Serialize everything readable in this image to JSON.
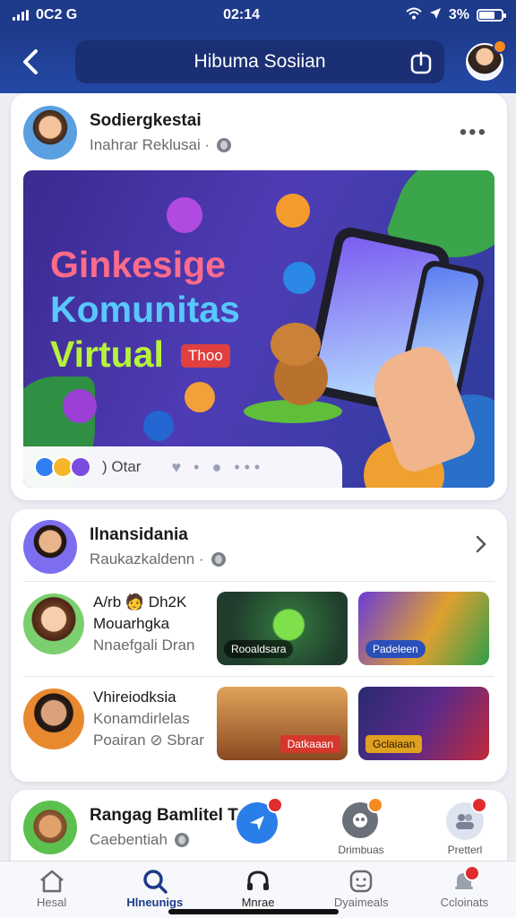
{
  "status": {
    "carrier": "0C2 G",
    "time": "02:14",
    "battery": "3%"
  },
  "header": {
    "title": "Hibuma Sosiian"
  },
  "post": {
    "author": "Sodiergkestai",
    "subtitle": "Inahrar Reklusai ·",
    "banner": {
      "line1": "Ginkesige",
      "line2": "Komunitas",
      "line3": "Virtual",
      "badge": "Thoo"
    },
    "reactions_count": ") Otar"
  },
  "friends_card": {
    "name": "Ilnansidania",
    "subtitle": "Raukazkaldenn ·",
    "rows": [
      {
        "line1": "A/rb 🧑 Dh2K",
        "line2": "Mouarhgka",
        "line3": "Nnaefgali Dran",
        "thumb1_label": "Rooaldsara",
        "thumb2_label": "Padeleen"
      },
      {
        "line1": "Vhireiodksia",
        "line2": "Konamdirlelas",
        "line3": "Poairan ⊘ Sbrar",
        "thumb1_label": "Datkaaan",
        "thumb2_label": "Gclaiaan"
      }
    ]
  },
  "bottom_card": {
    "name": "Rangag Bamlitel T",
    "subtitle": "Caebentiah",
    "fab1_label": "Drimbuas",
    "fab2_label": "Pretterl"
  },
  "nav": {
    "items": [
      "Hesal",
      "Hlneunigs",
      "Mnrae",
      "Dyaimeals",
      "Ccloinats"
    ],
    "active_index": 1
  },
  "colors": {
    "primary": "#1e3a8a",
    "badge_red": "#e02c2c",
    "badge_orange": "#f58a1f"
  }
}
